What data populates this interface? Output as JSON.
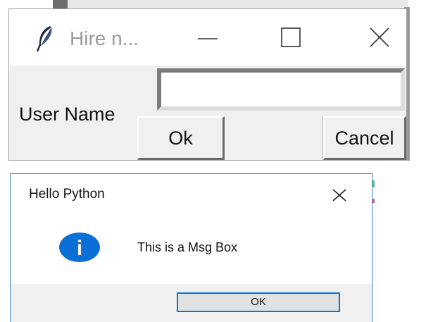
{
  "tk_window": {
    "title": "Hire n...",
    "icon": "feather-icon",
    "label": "User Name",
    "entry_value": "",
    "buttons": {
      "ok": "Ok",
      "cancel": "Cancel"
    }
  },
  "message_box": {
    "title": "Hello Python",
    "icon": "info-icon",
    "icon_glyph": "i",
    "message": "This is a Msg Box",
    "ok_label": "OK",
    "accent_color": "#0078d7"
  }
}
